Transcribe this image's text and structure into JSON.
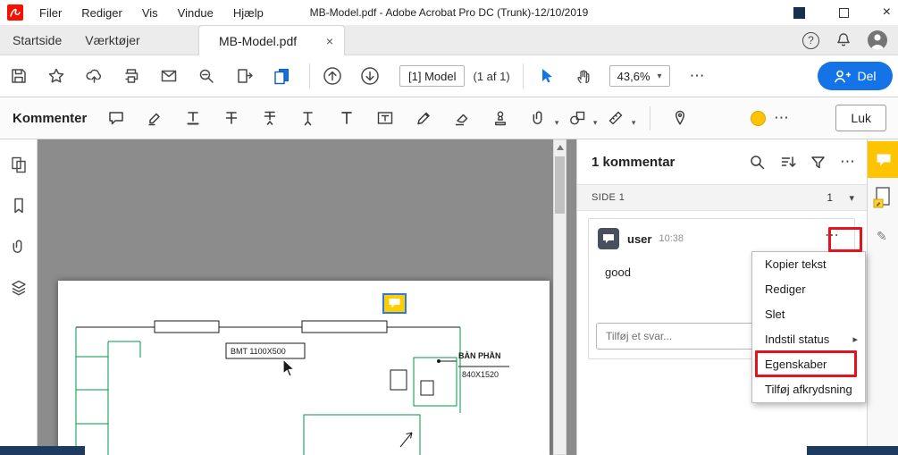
{
  "titlebar": {
    "menus": [
      "Filer",
      "Rediger",
      "Vis",
      "Vindue",
      "Hjælp"
    ],
    "title": "MB-Model.pdf - Adobe Acrobat Pro DC (Trunk)-12/10/2019"
  },
  "tabs": {
    "home": "Startside",
    "tools": "Værktøjer",
    "document": "MB-Model.pdf"
  },
  "toolbar": {
    "page_box": "[1] Model",
    "page_count": "(1 af 1)",
    "zoom": "43,6%",
    "share": "Del"
  },
  "comment_toolbar": {
    "title": "Kommenter",
    "close": "Luk"
  },
  "panel": {
    "header": "1 kommentar",
    "section": "SIDE 1",
    "section_count": "1",
    "comment": {
      "author": "user",
      "time": "10:38",
      "body": "good"
    },
    "reply_placeholder": "Tilføj et svar..."
  },
  "context_menu": {
    "items": [
      {
        "label": "Kopier tekst"
      },
      {
        "label": "Rediger"
      },
      {
        "label": "Slet"
      },
      {
        "label": "Indstil status",
        "submenu": true
      },
      {
        "label": "Egenskaber",
        "annotated": true
      },
      {
        "label": "Tilføj afkrydsning"
      }
    ]
  },
  "drawing": {
    "label_box": "BMT 1100X500",
    "part_name": "BÀN PHẦN",
    "part_size": "840X1520"
  },
  "icons": {
    "ellipsis": "⋯",
    "caret": "▾",
    "submenu_arrow": "▸",
    "close_x": "×",
    "help": "?",
    "pen": "✎"
  },
  "colors": {
    "accent_blue": "#1473e6",
    "acrobat_red": "#fa0f00",
    "annotation_red": "#e2151c",
    "comment_yellow": "#ffc400",
    "drawing_green": "#009a44",
    "taskbar_navy": "#1d3b60"
  }
}
